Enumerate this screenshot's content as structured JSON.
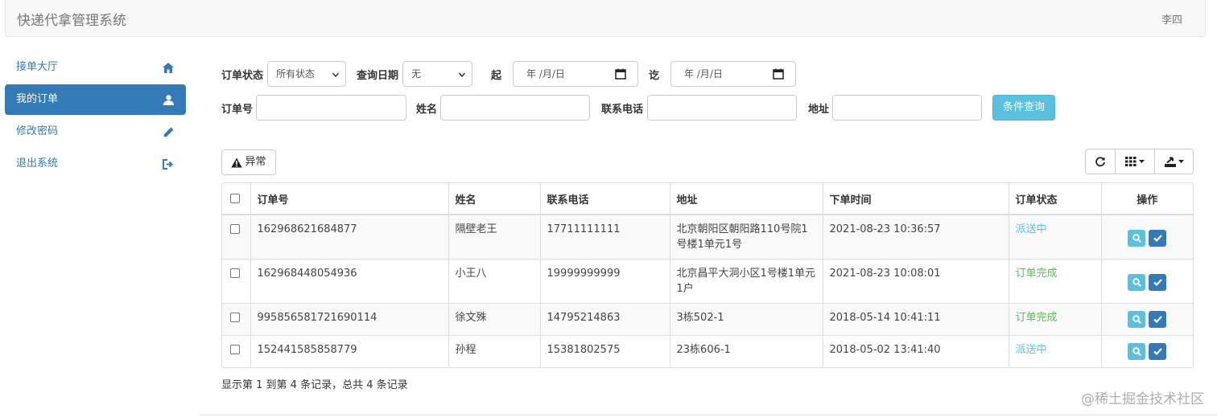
{
  "navbar": {
    "brand": "快递代拿管理系统",
    "user": "李四"
  },
  "sidebar": {
    "items": [
      {
        "label": "接单大厅",
        "icon": "home-icon",
        "active": false
      },
      {
        "label": "我的订单",
        "icon": "user-icon",
        "active": true
      },
      {
        "label": "修改密码",
        "icon": "pencil-icon",
        "active": false
      },
      {
        "label": "退出系统",
        "icon": "logout-icon",
        "active": false
      }
    ]
  },
  "filters": {
    "order_status_label": "订单状态",
    "order_status_value": "所有状态",
    "query_date_label": "查询日期",
    "query_date_value": "无",
    "from_label": "起",
    "from_value": "年 /月/日",
    "to_label": "讫",
    "to_value": "年 /月/日",
    "order_no_label": "订单号",
    "order_no_value": "",
    "name_label": "姓名",
    "name_value": "",
    "phone_label": "联系电话",
    "phone_value": "",
    "address_label": "地址",
    "address_value": "",
    "query_button": "条件查询"
  },
  "toolbar": {
    "exception_button": "异常",
    "icons": [
      "refresh-icon",
      "columns-icon",
      "export-icon"
    ]
  },
  "table": {
    "headers": [
      "订单号",
      "姓名",
      "联系电话",
      "地址",
      "下单时间",
      "订单状态",
      "操作"
    ],
    "rows": [
      {
        "order_no": "162968621684877",
        "name": "隔壁老王",
        "phone": "17711111111",
        "address": "北京朝阳区朝阳路110号院1号楼1单元1号",
        "time": "2021-08-23 10:36:57",
        "status": "派送中",
        "status_color": "#5bc0de"
      },
      {
        "order_no": "162968448054936",
        "name": "小王八",
        "phone": "19999999999",
        "address": "北京昌平大洞小区1号楼1单元1户",
        "time": "2021-08-23 10:08:01",
        "status": "订单完成",
        "status_color": "#5cb85c"
      },
      {
        "order_no": "995856581721690114",
        "name": "徐文殊",
        "phone": "14795214863",
        "address": "3栋502-1",
        "time": "2018-05-14 10:41:11",
        "status": "订单完成",
        "status_color": "#5cb85c"
      },
      {
        "order_no": "152441585858779",
        "name": "孙程",
        "phone": "15381802575",
        "address": "23栋606-1",
        "time": "2018-05-02 13:41:40",
        "status": "派送中",
        "status_color": "#5bc0de"
      }
    ]
  },
  "pager": {
    "summary": "显示第 1 到第 4 条记录，总共 4 条记录"
  },
  "watermark": {
    "text": "@稀土掘金技术社区"
  },
  "colors": {
    "primary": "#337ab7",
    "info": "#5bc0de",
    "success": "#5cb85c"
  }
}
